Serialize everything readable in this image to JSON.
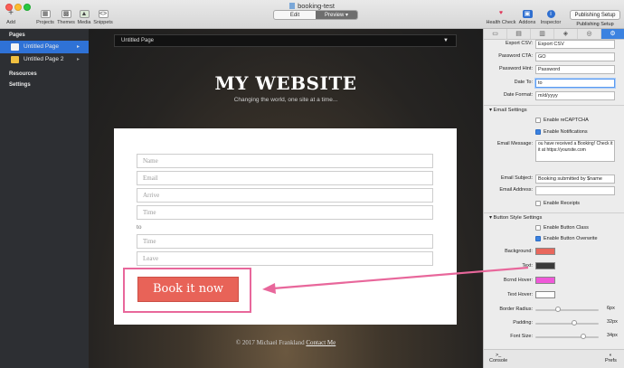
{
  "window": {
    "title": "booking-test"
  },
  "toolbar": {
    "add": "Add",
    "projects": "Projects",
    "themes": "Themes",
    "media": "Media",
    "snippets": "Snippets",
    "edit": "Edit",
    "preview": "Preview",
    "health_check": "Health Check",
    "addons": "Addons",
    "inspector": "Inspector",
    "publishing_setup_button": "Publishing Setup",
    "publishing_setup_label": "Publishing Setup"
  },
  "sidebar": {
    "pages_header": "Pages",
    "pages": [
      {
        "label": "Untitled Page",
        "selected": true
      },
      {
        "label": "Untitled Page 2",
        "selected": false
      }
    ],
    "resources": "Resources",
    "settings": "Settings"
  },
  "preview": {
    "page_selector": "Untitled Page",
    "site_title": "MY WEBSITE",
    "site_subtitle": "Changing the world, one site at a time...",
    "form": {
      "name": "Name",
      "email": "Email",
      "arrive": "Arrive",
      "time1": "Time",
      "to": "to",
      "time2": "Time",
      "leave": "Leave",
      "book_button": "Book it now"
    },
    "footer_text": "© 2017 Michael Frankland",
    "footer_link": "Contact Me"
  },
  "inspector": {
    "export_csv_label": "Export CSV:",
    "export_csv_value": "Export CSV",
    "password_cta_label": "Password CTA:",
    "password_cta_value": "GO",
    "password_hint_label": "Password Hint:",
    "password_hint_value": "Password",
    "date_to_label": "Date To:",
    "date_to_value": "to",
    "date_format_label": "Date Format:",
    "date_format_value": "m/d/yyyy",
    "email_settings": "Email Settings",
    "enable_recaptcha": "Enable reCAPTCHA",
    "enable_notifications": "Enable Notifications",
    "email_message_label": "Email Message:",
    "email_message_value": "ou have received a Booking! Check it it at https://yoursite.com",
    "email_subject_label": "Email Subject:",
    "email_subject_value": "Booking submitted by $name",
    "email_address_label": "Email Address:",
    "enable_receipts": "Enable Receipts",
    "button_style_settings": "Button Style Settings",
    "enable_button_class": "Enable Button Class",
    "enable_button_overwrite": "Enable Button Overwrite",
    "background_label": "Background:",
    "text_label": "Text:",
    "bcrnd_hover_label": "Bcrnd Hover:",
    "text_hover_label": "Text Hover:",
    "border_radius_label": "Border Radius:",
    "border_radius_value": "6px",
    "padding_label": "Padding:",
    "padding_value": "32px",
    "font_size_label": "Font Size:",
    "font_size_value": "34px",
    "console": "Console",
    "prefs": "Prefs",
    "colors": {
      "background": "#e8675c",
      "text": "#3a3a3a",
      "bcrnd_hover": "#ef58d8",
      "text_hover": "#ffffff"
    },
    "sliders": {
      "border_radius": 0.35,
      "padding": 0.62,
      "font_size": 0.78
    }
  }
}
